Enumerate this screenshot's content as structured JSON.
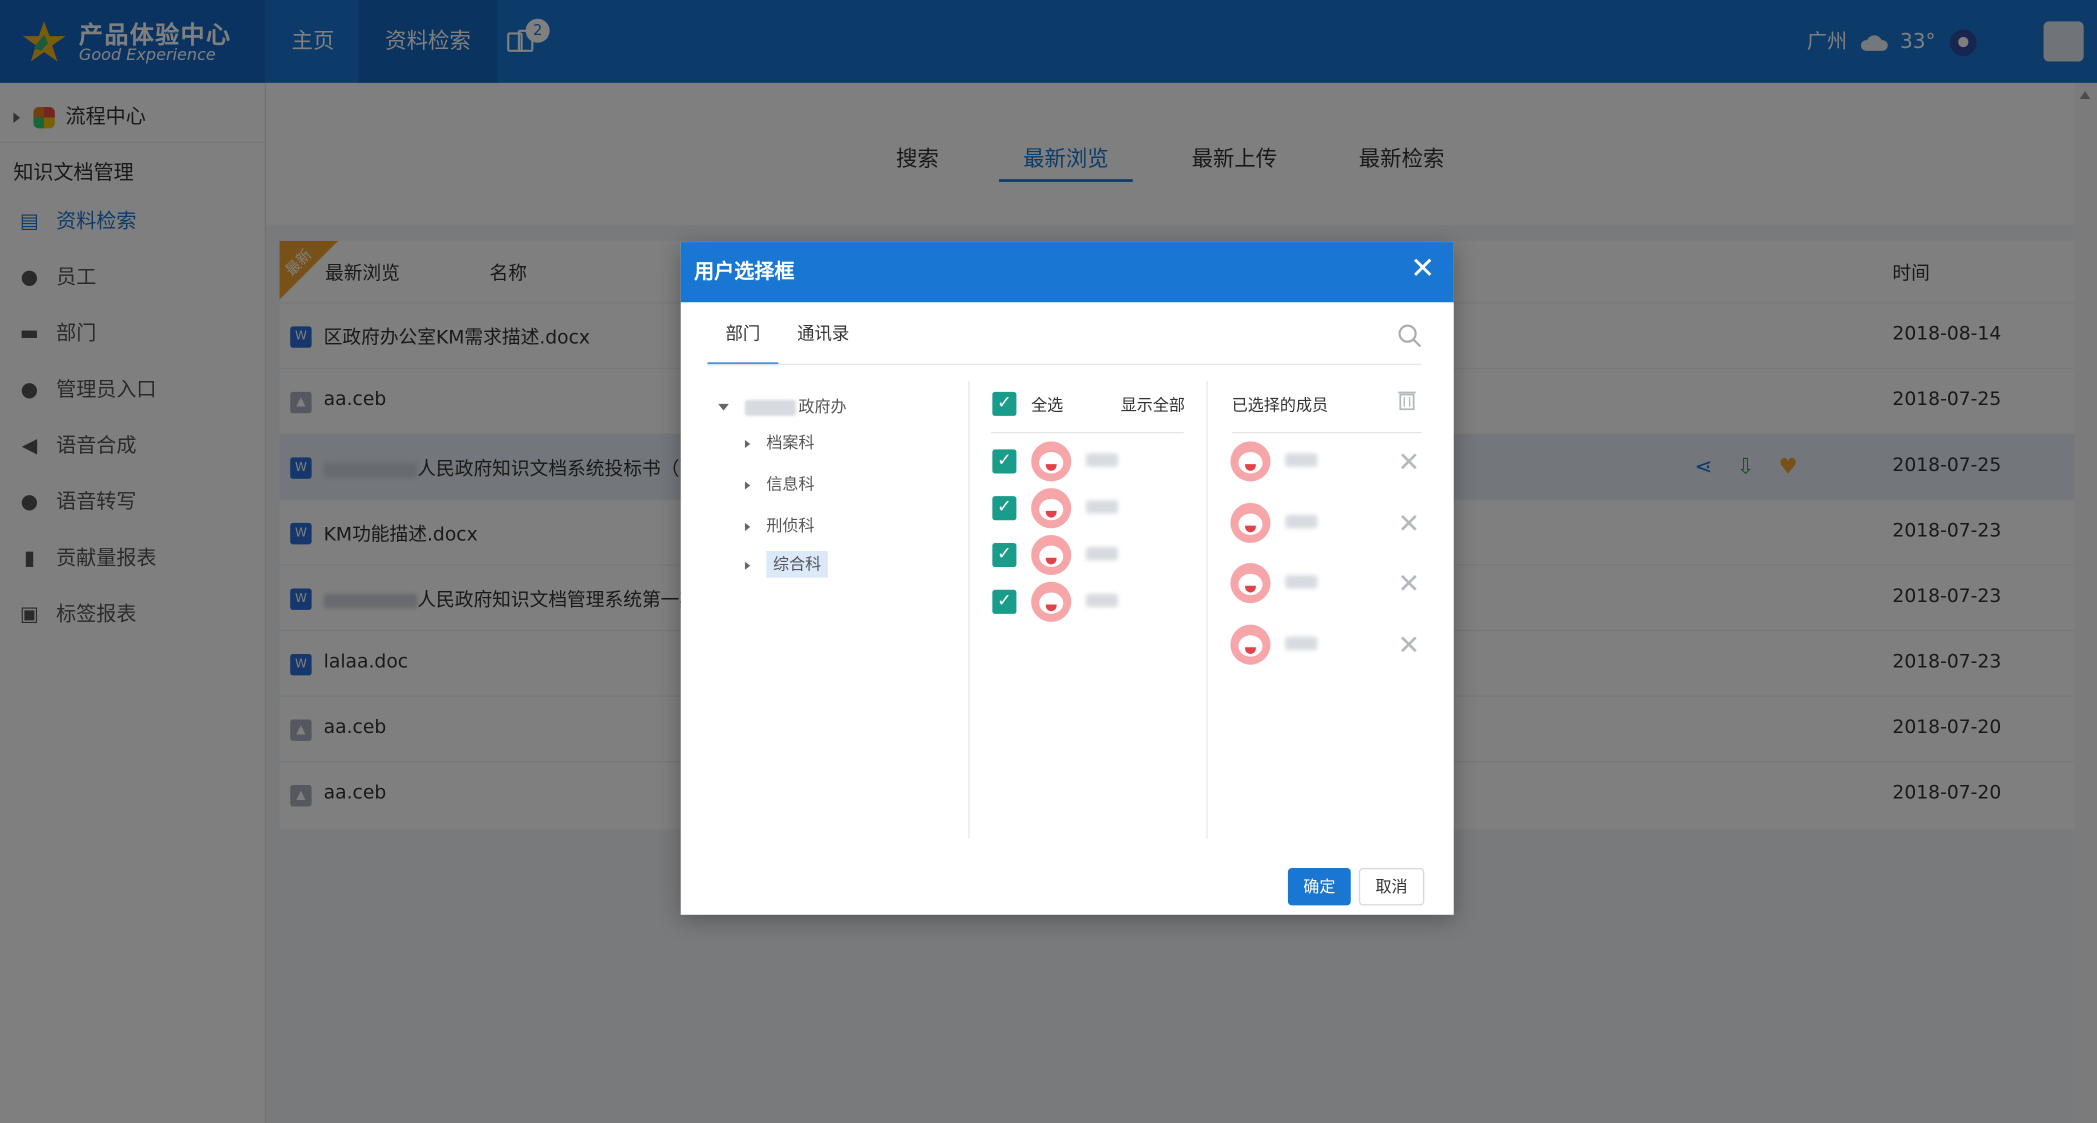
{
  "header": {
    "logo_cn": "产品体验中心",
    "logo_en": "Good Experience",
    "nav": [
      {
        "label": "主页"
      },
      {
        "label": "资料检索"
      }
    ],
    "notif_count": "2",
    "city": "广州",
    "temperature": "33°"
  },
  "sidebar": {
    "flow_center": "流程中心",
    "section_title": "知识文档管理",
    "items": [
      {
        "label": "资料检索",
        "icon": "document-search-icon"
      },
      {
        "label": "员工",
        "icon": "person-icon"
      },
      {
        "label": "部门",
        "icon": "folder-icon"
      },
      {
        "label": "管理员入口",
        "icon": "admin-icon"
      },
      {
        "label": "语音合成",
        "icon": "speaker-icon"
      },
      {
        "label": "语音转写",
        "icon": "microphone-icon"
      },
      {
        "label": "贡献量报表",
        "icon": "bar-chart-icon"
      },
      {
        "label": "标签报表",
        "icon": "presentation-icon"
      }
    ]
  },
  "main": {
    "tabs": [
      {
        "label": "搜索"
      },
      {
        "label": "最新浏览"
      },
      {
        "label": "最新上传"
      },
      {
        "label": "最新检索"
      }
    ],
    "ribbon": "最新",
    "columns": {
      "section": "最新浏览",
      "name": "名称",
      "time": "时间"
    },
    "rows": [
      {
        "type": "word",
        "name": "区政府办公室KM需求描述.docx",
        "date": "2018-08-14"
      },
      {
        "type": "ceb",
        "name": "aa.ceb",
        "date": "2018-07-25"
      },
      {
        "type": "word",
        "name": "人民政府知识文档系统投标书（副本",
        "date": "2018-07-25"
      },
      {
        "type": "word",
        "name": "KM功能描述.docx",
        "date": "2018-07-23"
      },
      {
        "type": "word",
        "name": "人民政府知识文档管理系统第一期",
        "date": "2018-07-23"
      },
      {
        "type": "word",
        "name": "lalaa.doc",
        "date": "2018-07-23"
      },
      {
        "type": "ceb",
        "name": "aa.ceb",
        "date": "2018-07-20"
      },
      {
        "type": "ceb",
        "name": "aa.ceb",
        "date": "2018-07-20"
      }
    ]
  },
  "dialog": {
    "title": "用户选择框",
    "tabs": [
      {
        "label": "部门"
      },
      {
        "label": "通讯录"
      }
    ],
    "tree_root_suffix": "政府办",
    "tree_items": [
      {
        "label": "档案科"
      },
      {
        "label": "信息科"
      },
      {
        "label": "刑侦科"
      },
      {
        "label": "综合科"
      }
    ],
    "select_all": "全选",
    "show_all": "显示全部",
    "selected_title": "已选择的成员",
    "ok": "确定",
    "cancel": "取消"
  },
  "colors": {
    "primary": "#1976d2",
    "checkbox": "#1a9c8a",
    "ribbon": "#f0a330"
  }
}
